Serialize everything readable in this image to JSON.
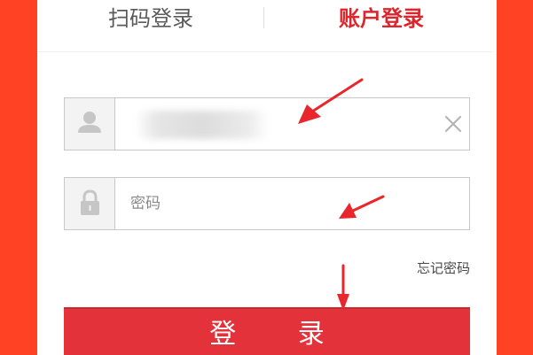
{
  "tabs": {
    "scan_label": "扫码登录",
    "account_label": "账户登录"
  },
  "username": {
    "value": "",
    "icon": "user-icon"
  },
  "password": {
    "placeholder": "密码",
    "icon": "lock-icon"
  },
  "links": {
    "forgot_password": "忘记密码"
  },
  "actions": {
    "login_label": "登 录"
  },
  "colors": {
    "background": "#ff4224",
    "accent": "#d9272d",
    "button": "#e4323a",
    "annotation_arrow": "#e8262c"
  }
}
